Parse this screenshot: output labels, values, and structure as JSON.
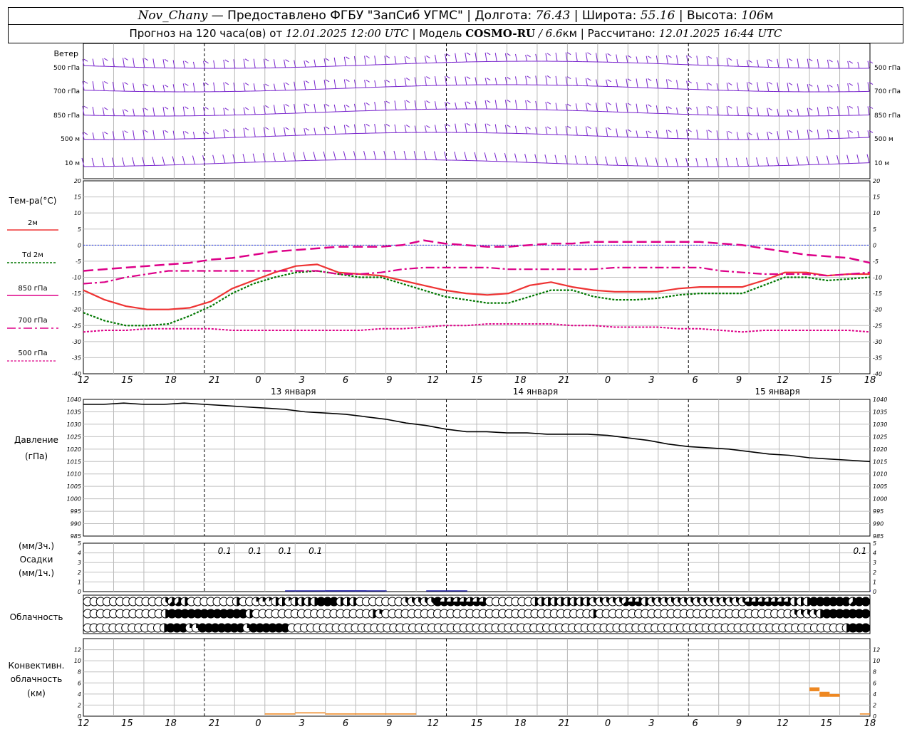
{
  "header": {
    "station": "Nov_Chany",
    "provider": "— Предоставлено ФГБУ \"ЗапСиб УГМС\" | Долгота:",
    "lon": "76.43",
    "lat_label": "| Широта:",
    "lat": "55.16",
    "alt_label": "| Высота:",
    "alt": "106",
    "alt_unit": "м",
    "forecast_label": "Прогноз на 120 часа(ов) от",
    "forecast_from": "12.01.2025 12:00 UTC",
    "model_label": "| Модель",
    "model": "COSMO-RU",
    "resolution": "/ 6.6",
    "res_unit": "км",
    "calc_label": "| Рассчитано:",
    "calc_time": "12.01.2025 16:44 UTC"
  },
  "labels": {
    "wind": "Ветер",
    "wind_levels": [
      "500 гПа",
      "700 гПа",
      "850 гПа",
      "500 м",
      "10 м"
    ],
    "temp_title": "Тем-ра(°C)",
    "t2m": "2м",
    "td_prefix": "Td",
    "td2m": "2м",
    "t850": "850 гПа",
    "t700": "700 гПа",
    "t500": "500 гПа",
    "pressure": "Давление",
    "pressure_unit": "(гПа)",
    "precip_unit3": "(мм/3ч.)",
    "precip": "Осадки",
    "precip_unit1": "(мм/1ч.)",
    "cloud": "Облачность",
    "conv1": "Конвективн.",
    "conv2": "облачность",
    "conv3": "(км)"
  },
  "colors": {
    "t2m": "#ee3333",
    "td2m": "#007700",
    "t850": "#dd0088",
    "t700": "#dd0088",
    "t500": "#dd0088",
    "wind": "#7722cc",
    "pressure": "#000000",
    "precip": "#2222aa",
    "convective": "#ee8822"
  },
  "chart_data": {
    "type": "line",
    "x_hours_ticks": [
      "12",
      "15",
      "18",
      "21",
      "0",
      "3",
      "6",
      "9",
      "12",
      "15",
      "18",
      "21",
      "0",
      "3",
      "6",
      "9",
      "12",
      "15",
      "18"
    ],
    "day_labels": [
      "13 января",
      "14 января",
      "15 января"
    ],
    "temperature": {
      "ylim": [
        -40,
        20
      ],
      "yticks": [
        20,
        15,
        10,
        5,
        0,
        -5,
        -10,
        -15,
        -20,
        -25,
        -30,
        -35,
        -40
      ],
      "series": [
        {
          "name": "2м",
          "values": [
            -14,
            -17,
            -19,
            -20,
            -20,
            -19.5,
            -17.5,
            -13.5,
            -11,
            -8.5,
            -6.5,
            -6,
            -8.5,
            -9,
            -9.5,
            -11,
            -12.5,
            -14,
            -15,
            -15.5,
            -15,
            -12.5,
            -11.5,
            -13,
            -14,
            -14.5,
            -14.5,
            -14.5,
            -13.5,
            -13,
            -13,
            -13,
            -11,
            -8.5,
            -8.5,
            -9.5,
            -9,
            -9
          ]
        },
        {
          "name": "Td 2м",
          "values": [
            -21,
            -23.5,
            -25,
            -25,
            -24.5,
            -22,
            -19,
            -15,
            -12,
            -10,
            -8.5,
            -8,
            -9,
            -10,
            -10,
            -12,
            -14,
            -16,
            -17,
            -18,
            -18,
            -16,
            -14,
            -14,
            -16,
            -17,
            -17,
            -16.5,
            -15.5,
            -15,
            -15,
            -15,
            -12.5,
            -10,
            -10,
            -11,
            -10.5,
            -10
          ]
        },
        {
          "name": "850 гПа",
          "values": [
            -8,
            -7.5,
            -7,
            -6.5,
            -6,
            -5.5,
            -4.5,
            -4,
            -3,
            -2,
            -1.5,
            -1,
            -0.5,
            -0.5,
            -0.5,
            0,
            1.5,
            0.5,
            0,
            -0.5,
            -0.5,
            0,
            0.5,
            0.5,
            1,
            1,
            1,
            1,
            1,
            1,
            0.5,
            0,
            -1,
            -2,
            -3,
            -3.5,
            -4,
            -5.5
          ]
        },
        {
          "name": "700 гПа",
          "values": [
            -12,
            -11.5,
            -10,
            -9,
            -8,
            -8,
            -8,
            -8,
            -8,
            -8,
            -8,
            -8,
            -9,
            -9,
            -8.5,
            -7.5,
            -7,
            -7,
            -7,
            -7,
            -7.5,
            -7.5,
            -7.5,
            -7.5,
            -7.5,
            -7,
            -7,
            -7,
            -7,
            -7,
            -8,
            -8.5,
            -9,
            -9,
            -9,
            -9.5,
            -9,
            -8.5
          ]
        },
        {
          "name": "500 гПа",
          "values": [
            -27,
            -26.5,
            -26.5,
            -26,
            -26,
            -26,
            -26,
            -26.5,
            -26.5,
            -26.5,
            -26.5,
            -26.5,
            -26.5,
            -26.5,
            -26,
            -26,
            -25.5,
            -25,
            -25,
            -24.5,
            -24.5,
            -24.5,
            -24.5,
            -25,
            -25,
            -25.5,
            -25.5,
            -25.5,
            -26,
            -26,
            -26.5,
            -27,
            -26.5,
            -26.5,
            -26.5,
            -26.5,
            -26.5,
            -27
          ]
        }
      ]
    },
    "pressure": {
      "ylim": [
        985,
        1040
      ],
      "yticks": [
        1040,
        1035,
        1030,
        1025,
        1020,
        1015,
        1010,
        1005,
        1000,
        995,
        990,
        985
      ],
      "values": [
        1038,
        1038,
        1038.5,
        1038,
        1038,
        1038.5,
        1038,
        1037.5,
        1037,
        1036.5,
        1036,
        1035,
        1034.5,
        1034,
        1033,
        1032,
        1030.5,
        1029.5,
        1028,
        1027,
        1027,
        1026.5,
        1026.5,
        1026,
        1026,
        1026,
        1025.5,
        1024.5,
        1023.5,
        1022,
        1021,
        1020.5,
        1020,
        1019,
        1018,
        1017.5,
        1016.5,
        1016,
        1015.5,
        1015
      ]
    },
    "precipitation": {
      "ylim": [
        0,
        5
      ],
      "yticks": [
        5,
        4,
        3,
        2,
        1,
        0
      ],
      "labels": [
        {
          "hour": 15,
          "text": "0.1"
        },
        {
          "hour": 18,
          "text": "0.1"
        },
        {
          "hour": 21,
          "text": "0.1"
        },
        {
          "hour": 24,
          "text": "0.1"
        },
        {
          "hour": 78,
          "text": "0.1"
        }
      ]
    },
    "cloud_cover_eighths": {
      "high": [
        0,
        0,
        0,
        0,
        0,
        0,
        0,
        0,
        0,
        0,
        0,
        0,
        3,
        5,
        5,
        4,
        0,
        0,
        0,
        0,
        0,
        0,
        0,
        4,
        0,
        0,
        2,
        2,
        1,
        4,
        4,
        1,
        4,
        4,
        4,
        4,
        8,
        8,
        8,
        4,
        4,
        4,
        0,
        0,
        0,
        0,
        0,
        0,
        0,
        3,
        3,
        3,
        3,
        3,
        8,
        6,
        6,
        6,
        6,
        6,
        6,
        6,
        0,
        0,
        0,
        0,
        0,
        0,
        0,
        4,
        4,
        4,
        4,
        4,
        4,
        4,
        4,
        4,
        3,
        3,
        3,
        3,
        3,
        5,
        6,
        6,
        4,
        3,
        3,
        3,
        3,
        3,
        3,
        3,
        3,
        3,
        3,
        3,
        3,
        3,
        3,
        3,
        6,
        6,
        6,
        6,
        6,
        6,
        6,
        4,
        4,
        4,
        8,
        8,
        8,
        8,
        8,
        8,
        5,
        8,
        8
      ],
      "mid": [
        0,
        0,
        0,
        0,
        0,
        0,
        0,
        0,
        0,
        0,
        0,
        0,
        4,
        8,
        8,
        8,
        8,
        8,
        8,
        8,
        8,
        8,
        8,
        8,
        8,
        4,
        0,
        0,
        0,
        0,
        0,
        0,
        0,
        0,
        0,
        0,
        0,
        0,
        0,
        0,
        0,
        0,
        0,
        0,
        4,
        2,
        0,
        0,
        0,
        0,
        0,
        0,
        0,
        0,
        0,
        0,
        0,
        0,
        0,
        0,
        0,
        0,
        0,
        0,
        0,
        0,
        0,
        0,
        0,
        0,
        0,
        0,
        0,
        0,
        0,
        0,
        0,
        0,
        4,
        0,
        0,
        0,
        0,
        0,
        0,
        0,
        0,
        0,
        0,
        0,
        0,
        0,
        0,
        0,
        0,
        0,
        0,
        0,
        0,
        0,
        0,
        0,
        0,
        0,
        0,
        0,
        0,
        0,
        0,
        3,
        3,
        3,
        3,
        4,
        8,
        8,
        8,
        8,
        8,
        8,
        8
      ],
      "low": [
        0,
        0,
        0,
        0,
        0,
        0,
        0,
        0,
        0,
        0,
        0,
        0,
        4,
        8,
        8,
        8,
        2,
        2,
        8,
        8,
        8,
        8,
        8,
        8,
        8,
        2,
        8,
        8,
        8,
        8,
        8,
        8,
        0,
        0,
        0,
        0,
        0,
        0,
        0,
        0,
        0,
        0,
        0,
        0,
        0,
        0,
        0,
        0,
        0,
        0,
        0,
        0,
        0,
        0,
        0,
        0,
        0,
        0,
        0,
        0,
        0,
        0,
        0,
        0,
        0,
        0,
        0,
        0,
        0,
        0,
        0,
        0,
        0,
        0,
        0,
        0,
        0,
        0,
        0,
        0,
        0,
        0,
        0,
        0,
        0,
        0,
        0,
        0,
        0,
        0,
        0,
        0,
        0,
        0,
        0,
        0,
        0,
        0,
        0,
        0,
        0,
        0,
        0,
        0,
        0,
        0,
        0,
        0,
        0,
        0,
        0,
        0,
        0,
        0,
        0,
        0,
        0,
        0,
        0,
        4,
        8,
        8,
        8
      ]
    },
    "convective_cloud_km": {
      "ylim": [
        0,
        14
      ],
      "yticks": [
        12,
        10,
        8,
        6,
        4,
        2,
        0
      ],
      "segments": [
        {
          "from_hour": 18,
          "to_hour": 21,
          "base": 0.3,
          "top": 0.5
        },
        {
          "from_hour": 21,
          "to_hour": 24,
          "base": 0.5,
          "top": 0.7
        },
        {
          "from_hour": 24,
          "to_hour": 33,
          "base": 0.3,
          "top": 0.5
        },
        {
          "from_hour": 72,
          "to_hour": 73,
          "base": 4.5,
          "top": 5.2
        },
        {
          "from_hour": 73,
          "to_hour": 74,
          "base": 3.5,
          "top": 4.4
        },
        {
          "from_hour": 74,
          "to_hour": 75,
          "base": 3.5,
          "top": 4.0
        },
        {
          "from_hour": 77,
          "to_hour": 78,
          "base": 0.3,
          "top": 0.5
        }
      ]
    }
  }
}
